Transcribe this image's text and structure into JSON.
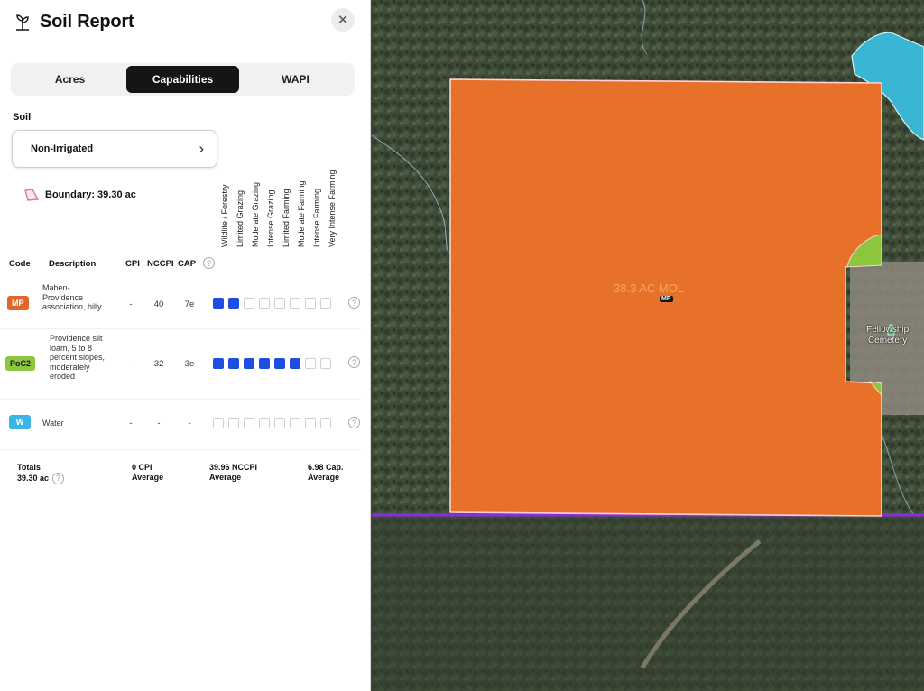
{
  "header": {
    "title": "Soil Report",
    "close_glyph": "✕"
  },
  "tabs": [
    {
      "label": "Acres",
      "active": false
    },
    {
      "label": "Capabilities",
      "active": true
    },
    {
      "label": "WAPI",
      "active": false
    }
  ],
  "soil": {
    "label": "Soil",
    "selected": "Non-Irrigated",
    "chevron": "›"
  },
  "boundary": {
    "text": "Boundary: 39.30 ac"
  },
  "columns": {
    "code": "Code",
    "description": "Description",
    "cpi": "CPI",
    "nccpi": "NCCPI",
    "cap": "CAP"
  },
  "capability_labels": [
    "Wildlife / Forestry",
    "Limited Grazing",
    "Moderate Grazing",
    "Intense Grazing",
    "Limited Farming",
    "Moderate Farming",
    "Intense Farming",
    "Very Intense Farming"
  ],
  "rows": [
    {
      "code": "MP",
      "color": "#e0662a",
      "text_color": "#ffffff",
      "description": "Maben-Providence association, hilly",
      "cpi": "-",
      "nccpi": "40",
      "cap": "7e",
      "capability_level": 2
    },
    {
      "code": "PoC2",
      "color": "#8cc63f",
      "text_color": "#1a1a1a",
      "description": "Providence silt loam, 5 to 8 percent slopes, moderately eroded",
      "cpi": "-",
      "nccpi": "32",
      "cap": "3e",
      "capability_level": 6
    },
    {
      "code": "W",
      "color": "#39b6e6",
      "text_color": "#ffffff",
      "description": "Water",
      "cpi": "-",
      "nccpi": "-",
      "cap": "-",
      "capability_level": 0
    }
  ],
  "totals": {
    "label": "Totals",
    "acres": "39.30 ac",
    "cpi_value": "0 CPI",
    "cpi_sub": "Average",
    "nccpi_value": "39.96 NCCPI",
    "nccpi_sub": "Average",
    "cap_value": "6.98 Cap.",
    "cap_sub": "Average"
  },
  "map": {
    "parcel_label": "38.3 AC MOL",
    "parcel_code": "MP",
    "cemetery_line1": "Fellowship",
    "cemetery_line2": "Cemetery",
    "parcel_color": "#e8712a",
    "pocket_color": "#8cc63f",
    "water_color": "#3ab5d4",
    "boundary_line_color": "#8a2be2"
  },
  "icons": {
    "logo": "plant-icon",
    "close": "close-icon",
    "help": "help-circle-icon",
    "chevron": "chevron-right-icon",
    "boundary": "polygon-icon",
    "cemetery": "cemetery-pin-icon"
  }
}
